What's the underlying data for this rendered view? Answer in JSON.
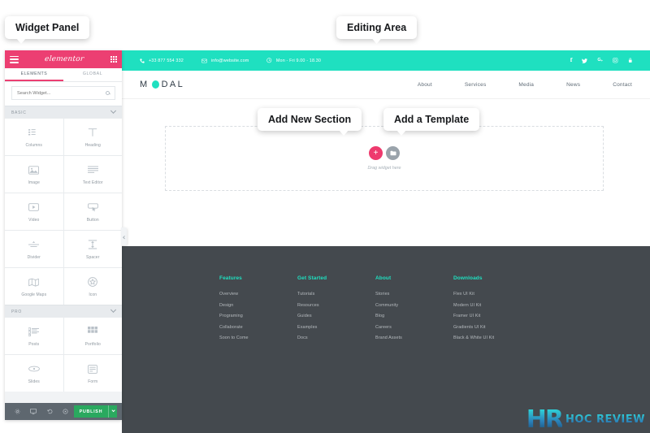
{
  "callouts": {
    "widget_panel": "Widget Panel",
    "editing_area": "Editing Area",
    "add_new_section": "Add New Section",
    "add_a_template": "Add a Template"
  },
  "panel": {
    "brand": "elementor",
    "menu_icon": "hamburger-icon",
    "grid_icon": "grid-icon",
    "tabs": [
      {
        "label": "ELEMENTS",
        "active": true
      },
      {
        "label": "GLOBAL",
        "active": false
      }
    ],
    "search": {
      "value": "",
      "placeholder": "Search Widget..."
    },
    "sections": [
      {
        "title": "BASIC",
        "widgets": [
          {
            "label": "Columns",
            "icon": "columns-icon"
          },
          {
            "label": "Heading",
            "icon": "heading-icon"
          },
          {
            "label": "Image",
            "icon": "image-icon"
          },
          {
            "label": "Text Editor",
            "icon": "text-editor-icon"
          },
          {
            "label": "Video",
            "icon": "video-icon"
          },
          {
            "label": "Button",
            "icon": "button-icon"
          },
          {
            "label": "Divider",
            "icon": "divider-icon"
          },
          {
            "label": "Spacer",
            "icon": "spacer-icon"
          },
          {
            "label": "Google Maps",
            "icon": "google-maps-icon"
          },
          {
            "label": "Icon",
            "icon": "star-icon"
          }
        ]
      },
      {
        "title": "PRO",
        "widgets": [
          {
            "label": "Posts",
            "icon": "posts-icon"
          },
          {
            "label": "Portfolio",
            "icon": "portfolio-icon"
          },
          {
            "label": "Slides",
            "icon": "slides-icon"
          },
          {
            "label": "Form",
            "icon": "form-icon"
          }
        ]
      }
    ],
    "footer": {
      "icons": [
        "settings-gear-icon",
        "responsive-monitor-icon",
        "history-undo-icon",
        "preview-icon"
      ],
      "publish_label": "PUBLISH",
      "publish_color": "#2aa95f"
    },
    "header_color": "#ec3f72",
    "collapse_handle": "panel-collapse-arrow"
  },
  "site": {
    "topbar": {
      "color": "#1fe0c0",
      "phone": "+33 877 554 332",
      "email": "info@website.com",
      "hours": "Mon - Fri 9.00 - 18.30",
      "social": [
        {
          "name": "facebook-icon",
          "glyph": "f"
        },
        {
          "name": "twitter-icon",
          "glyph": "✈"
        },
        {
          "name": "google-plus-icon",
          "glyph": "G+"
        },
        {
          "name": "instagram-icon",
          "glyph": "◎"
        },
        {
          "name": "lock-icon",
          "glyph": "■"
        }
      ]
    },
    "navbar": {
      "logo_prefix": "M",
      "logo_suffix": "DAL",
      "links": [
        "About",
        "Services",
        "Media",
        "News",
        "Contact"
      ]
    },
    "dropzone": {
      "add_section_glyph": "+",
      "template_icon": "folder-icon",
      "caption": "Drag widget here"
    },
    "footer": {
      "background": "#44494e",
      "heading_color": "#1fe0c0",
      "columns": [
        {
          "title": "Features",
          "links": [
            "Overview",
            "Design",
            "Programing",
            "Collaborate",
            "Soon to Come"
          ]
        },
        {
          "title": "Get Started",
          "links": [
            "Tutorials",
            "Resources",
            "Guides",
            "Examples",
            "Docs"
          ]
        },
        {
          "title": "About",
          "links": [
            "Stories",
            "Community",
            "Blog",
            "Careers",
            "Brand Assets"
          ]
        },
        {
          "title": "Downloads",
          "links": [
            "Flex UI Kit",
            "Modern UI Kit",
            "Framer UI Kit",
            "Gradients UI Kit",
            "Black & White UI Kit"
          ]
        }
      ]
    },
    "watermark": {
      "mark": "HR",
      "text": "HOC REVIEW"
    }
  }
}
